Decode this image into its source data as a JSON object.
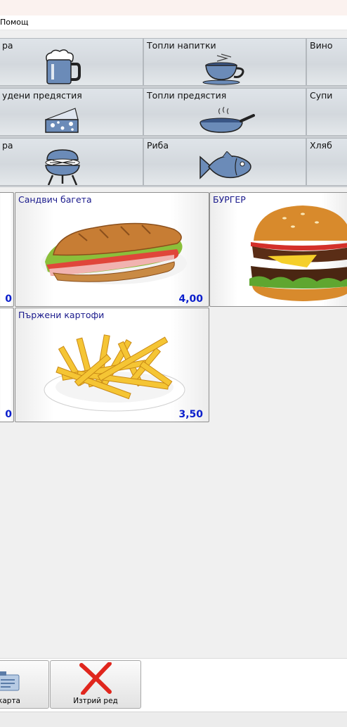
{
  "menubar": {
    "help": "Помощ"
  },
  "categories": [
    {
      "label": "ра",
      "icon": "beer-mug-icon"
    },
    {
      "label": "Топли напитки",
      "icon": "coffee-cup-icon"
    },
    {
      "label": "Вино",
      "icon": ""
    },
    {
      "label": "удени предястия",
      "icon": "cheese-icon"
    },
    {
      "label": "Топли предястия",
      "icon": "frying-pan-icon"
    },
    {
      "label": "Супи",
      "icon": ""
    },
    {
      "label": "ра",
      "icon": "grill-icon"
    },
    {
      "label": "Риба",
      "icon": "fish-icon"
    },
    {
      "label": "Хляб",
      "icon": ""
    }
  ],
  "products": [
    {
      "name": "",
      "price": "0"
    },
    {
      "name": "Сандвич багета",
      "price": "4,00"
    },
    {
      "name": "БУРГЕР",
      "price": ""
    },
    {
      "name": "",
      "price": "0"
    },
    {
      "name": "Пържени картофи",
      "price": "3,50"
    }
  ],
  "toolbar": {
    "card_label": "карта",
    "delete_row_label": "Изтрий ред"
  },
  "colors": {
    "price": "#0a1ecc",
    "product_name": "#1a1a8c",
    "delete_icon": "#e0261d"
  }
}
